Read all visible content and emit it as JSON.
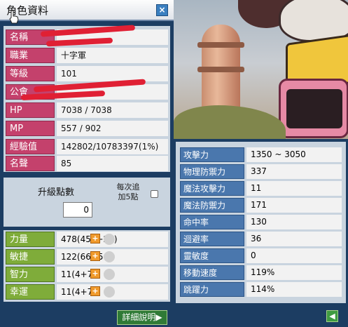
{
  "character": {
    "window_title": "角色資料",
    "close_glyph": "×",
    "info_rows": [
      {
        "label": "名稱",
        "value": ""
      },
      {
        "label": "職業",
        "value": "十字軍"
      },
      {
        "label": "等級",
        "value": "101"
      },
      {
        "label": "公會",
        "value": ""
      },
      {
        "label": "HP",
        "value": "7038 / 7038"
      },
      {
        "label": "MP",
        "value": "557 / 902"
      },
      {
        "label": "經驗值",
        "value": "142802/10783397(1%)"
      },
      {
        "label": "名聲",
        "value": "85"
      }
    ],
    "ability_points": {
      "title": "升級點數",
      "value": "0",
      "auto_label": "每次追加5點"
    },
    "stats": [
      {
        "label": "力量",
        "value": "478(451+27)",
        "plus": "+",
        "plus_enabled": true
      },
      {
        "label": "敏捷",
        "value": "122(66+56)",
        "plus": "+",
        "plus_enabled": true
      },
      {
        "label": "智力",
        "value": "11(4+7)",
        "plus": "+",
        "plus_enabled": true
      },
      {
        "label": "幸運",
        "value": "11(4+7)",
        "plus": "+",
        "plus_enabled": true
      }
    ],
    "detail_button": "詳細說明▶"
  },
  "detail": {
    "rows": [
      {
        "label": "攻擊力",
        "value": "1350 ~ 3050"
      },
      {
        "label": "物理防禦力",
        "value": "337"
      },
      {
        "label": "魔法攻擊力",
        "value": "11"
      },
      {
        "label": "魔法防禦力",
        "value": "171"
      },
      {
        "label": "命中率",
        "value": "130"
      },
      {
        "label": "迴避率",
        "value": "36"
      },
      {
        "label": "靈敏度",
        "value": "0"
      },
      {
        "label": "移動速度",
        "value": "119%"
      },
      {
        "label": "跳躍力",
        "value": "114%"
      }
    ],
    "collapse_glyph": "◀"
  },
  "colors": {
    "info_label": "#c4416c",
    "stat_label": "#7fac3a",
    "detail_label": "#4a77ad",
    "window_frame": "#1c3d62",
    "redaction": "#e02034"
  },
  "icons": [
    "hand-cursor-icon",
    "close-icon",
    "plus-icon",
    "collapse-arrow-icon"
  ]
}
